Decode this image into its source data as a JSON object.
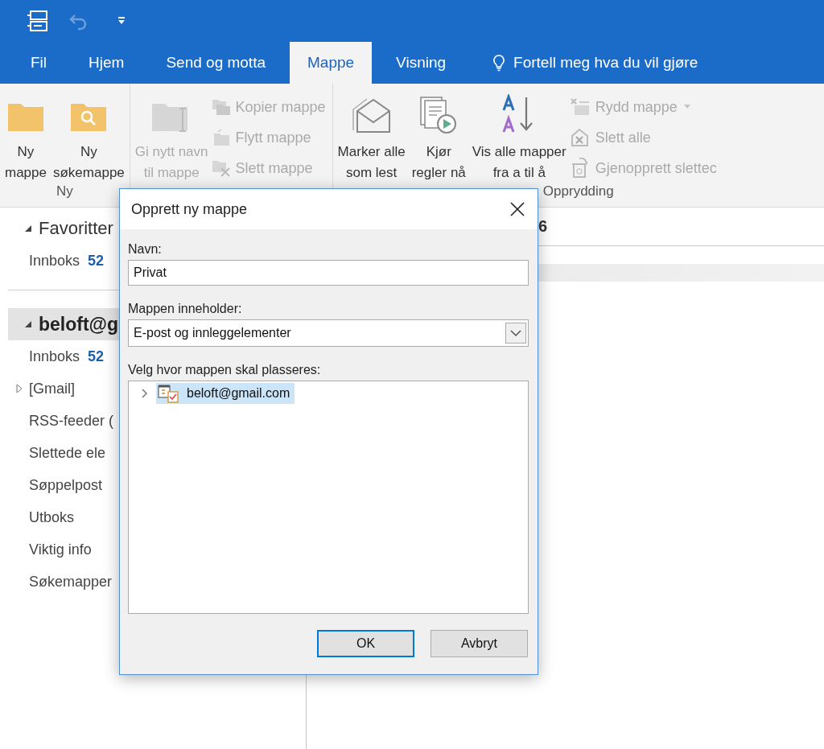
{
  "tabs": [
    {
      "label": "Fil",
      "selected": false
    },
    {
      "label": "Hjem",
      "selected": false
    },
    {
      "label": "Send og motta",
      "selected": false
    },
    {
      "label": "Mappe",
      "selected": true
    },
    {
      "label": "Visning",
      "selected": false
    }
  ],
  "tell_me": {
    "label": "Fortell meg hva du vil gjøre"
  },
  "ribbon": {
    "groups": [
      {
        "label": "Ny",
        "buttons": [
          {
            "kind": "folder",
            "lines": [
              "Ny",
              "mappe"
            ],
            "disabled": false
          },
          {
            "kind": "search-folder",
            "lines": [
              "Ny",
              "søkemappe"
            ],
            "disabled": false
          }
        ]
      },
      {
        "buttons": [
          {
            "kind": "rename",
            "lines": [
              "Gi nytt navn",
              "til mappe"
            ],
            "disabled": true
          },
          {
            "kind": "copy",
            "lines": [
              "Kopier mappe"
            ],
            "disabled": true
          },
          {
            "kind": "move",
            "lines": [
              "Flytt mappe"
            ],
            "disabled": true
          },
          {
            "kind": "delete",
            "lines": [
              "Slett mappe"
            ],
            "disabled": true
          }
        ]
      },
      {
        "label": "Opprydding",
        "buttons": [
          {
            "kind": "mark-read",
            "lines": [
              "Marker alle",
              "som lest"
            ],
            "disabled": false
          },
          {
            "kind": "run-rules",
            "lines": [
              "Kjør",
              "regler nå"
            ],
            "disabled": false
          },
          {
            "kind": "sort",
            "lines": [
              "Vis alle mapper",
              "fra a til å"
            ],
            "disabled": false
          },
          {
            "kind": "cleanup",
            "lines": [
              "Rydd mappe"
            ],
            "disabled": true
          },
          {
            "kind": "delete-all",
            "lines": [
              "Slett alle"
            ],
            "disabled": true
          },
          {
            "kind": "recover",
            "lines": [
              "Gjenopprett slettec"
            ],
            "disabled": true
          }
        ]
      }
    ]
  },
  "folder_pane": {
    "sections": [
      {
        "label": "Favoritter",
        "expanded": true,
        "selected": false,
        "items": [
          {
            "label": "Innboks",
            "count": "52"
          }
        ]
      },
      {
        "label": "beloft@g",
        "expanded": true,
        "selected": true,
        "items": [
          {
            "label": "Innboks",
            "count": "52"
          },
          {
            "label": "[Gmail]",
            "expanded": false
          },
          {
            "label": "RSS-feeder ("
          },
          {
            "label": "Slettede ele"
          },
          {
            "label": "Søppelpost"
          },
          {
            "label": "Utboks"
          },
          {
            "label": "Viktig info"
          },
          {
            "label": "Søkemapper"
          }
        ]
      }
    ]
  },
  "message_list": {
    "column_1": "6"
  },
  "dialog": {
    "title": "Opprett ny mappe",
    "name_label": "Navn:",
    "name_value": "Privat",
    "contains_label": "Mappen inneholder:",
    "contains_value": "E-post og innleggelementer",
    "location_label": "Velg hvor mappen skal plasseres:",
    "tree": [
      {
        "label": "beloft@gmail.com",
        "expanded": false,
        "selected": true
      }
    ],
    "buttons": [
      {
        "label": "OK",
        "default": true
      },
      {
        "label": "Avbryt",
        "default": false
      }
    ]
  }
}
